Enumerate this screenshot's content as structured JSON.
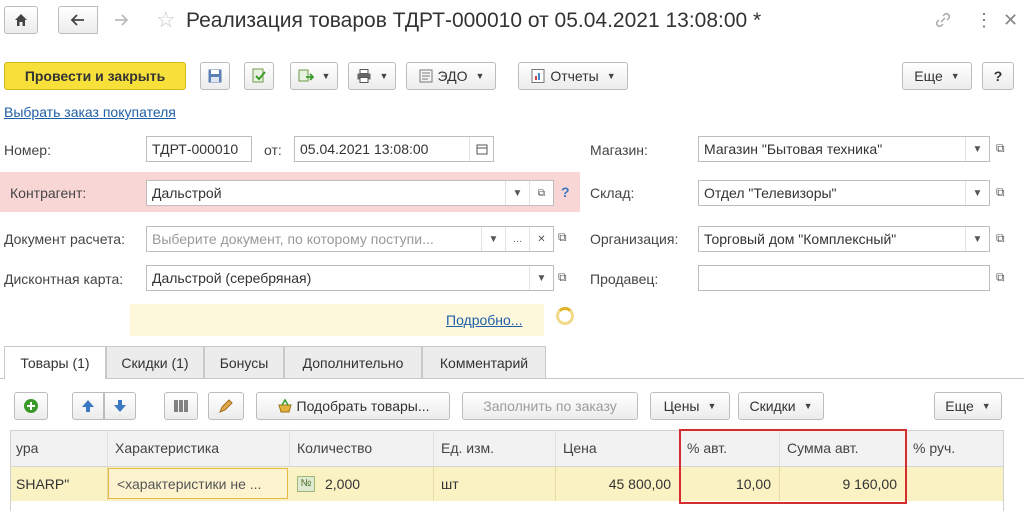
{
  "header": {
    "title": "Реализация товаров ТДРТ-000010 от 05.04.2021 13:08:00 *"
  },
  "toolbar": {
    "post_close": "Провести и закрыть",
    "edo": "ЭДО",
    "reports": "Отчеты",
    "more": "Еще",
    "help": "?"
  },
  "links": {
    "select_order": "Выбрать заказ покупателя",
    "details": "Подробно..."
  },
  "form": {
    "number_label": "Номер:",
    "number_value": "ТДРТ-000010",
    "from_label": "от:",
    "date_value": "05.04.2021 13:08:00",
    "counterparty_label": "Контрагент:",
    "counterparty_value": "Дальстрой",
    "settlement_label": "Документ расчета:",
    "settlement_placeholder": "Выберите документ, по которому поступи...",
    "discount_card_label": "Дисконтная карта:",
    "discount_card_value": "Дальстрой (серебряная)",
    "store_label": "Магазин:",
    "store_value": "Магазин \"Бытовая техника\"",
    "warehouse_label": "Склад:",
    "warehouse_value": "Отдел \"Телевизоры\"",
    "organization_label": "Организация:",
    "organization_value": "Торговый дом \"Комплексный\"",
    "seller_label": "Продавец:",
    "seller_value": ""
  },
  "tabs": [
    {
      "label": "Товары (1)"
    },
    {
      "label": "Скидки (1)"
    },
    {
      "label": "Бонусы"
    },
    {
      "label": "Дополнительно"
    },
    {
      "label": "Комментарий"
    }
  ],
  "table_toolbar": {
    "pick_goods": "Подобрать товары...",
    "fill_by_order": "Заполнить по заказу",
    "prices": "Цены",
    "discounts": "Скидки",
    "more": "Еще"
  },
  "table": {
    "columns": [
      "ура",
      "Характеристика",
      "Количество",
      "Ед. изм.",
      "Цена",
      "% авт.",
      "Сумма авт.",
      "% руч."
    ],
    "rows": [
      {
        "nomenclature": "SHARP\"",
        "characteristic": "<характеристики не ...",
        "quantity_icon": "№",
        "quantity": "2,000",
        "unit": "шт",
        "price": "45 800,00",
        "auto_percent": "10,00",
        "auto_sum": "9 160,00",
        "manual_percent": ""
      }
    ]
  },
  "colors": {
    "primary_button": "#f8e03b",
    "highlight_row": "#fbf2c3",
    "required_field": "#f9d6d6",
    "annotation_box": "#d42d2d",
    "link": "#1f5fa8"
  }
}
